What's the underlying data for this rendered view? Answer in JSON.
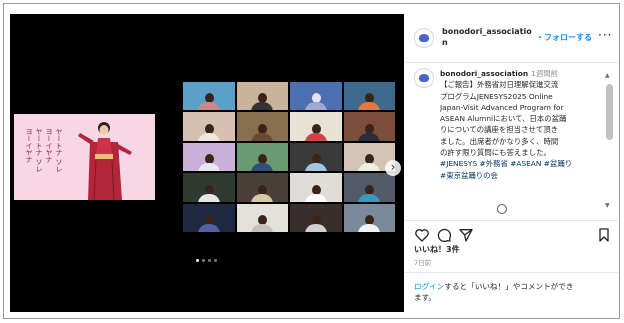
{
  "post": {
    "username": "bonodori_association",
    "username_line1": "bonodori_associatio",
    "username_line2": "n",
    "follow_label": "・フォローする",
    "more_label": "···",
    "time_ago": "1週間前",
    "caption_lines": [
      "【ご報告】外務省対日理解促進交流",
      "プログラムJENESYS2025 Online",
      "Japan-Visit Advanced Program for",
      "ASEAN Alumniにおいて、日本の盆踊",
      "りについての講座を担当させて頂き",
      "ました。出席者がかなり多く、時間",
      "の許す限り質問にも答えました。"
    ],
    "hashtags_line1": "#JENESYS #外務省 #ASEAN #盆踊り",
    "hashtags_line2": "#東京盆踊りの会",
    "likes": "いいね！3件",
    "date": "7日前",
    "comment_login": "ログイン",
    "comment_rest_line1": "すると「いいね！」やコメントができ",
    "comment_rest_line2": "ます。"
  },
  "media": {
    "slide_text": [
      "ヤートナ ソレ",
      "ヨーイヤナ",
      "ヤートナ ソレ",
      "ヨーイヤナ"
    ],
    "next_label": "›",
    "slide_count": 4,
    "current_slide": 1
  },
  "colors": {
    "link": "#0095f6",
    "hashtag": "#00376b",
    "kimono": "#b3263a",
    "card_bg": "#f7d6e6"
  },
  "icons": [
    "heart-icon",
    "comment-icon",
    "share-icon",
    "bookmark-icon",
    "chevron-right-icon"
  ]
}
